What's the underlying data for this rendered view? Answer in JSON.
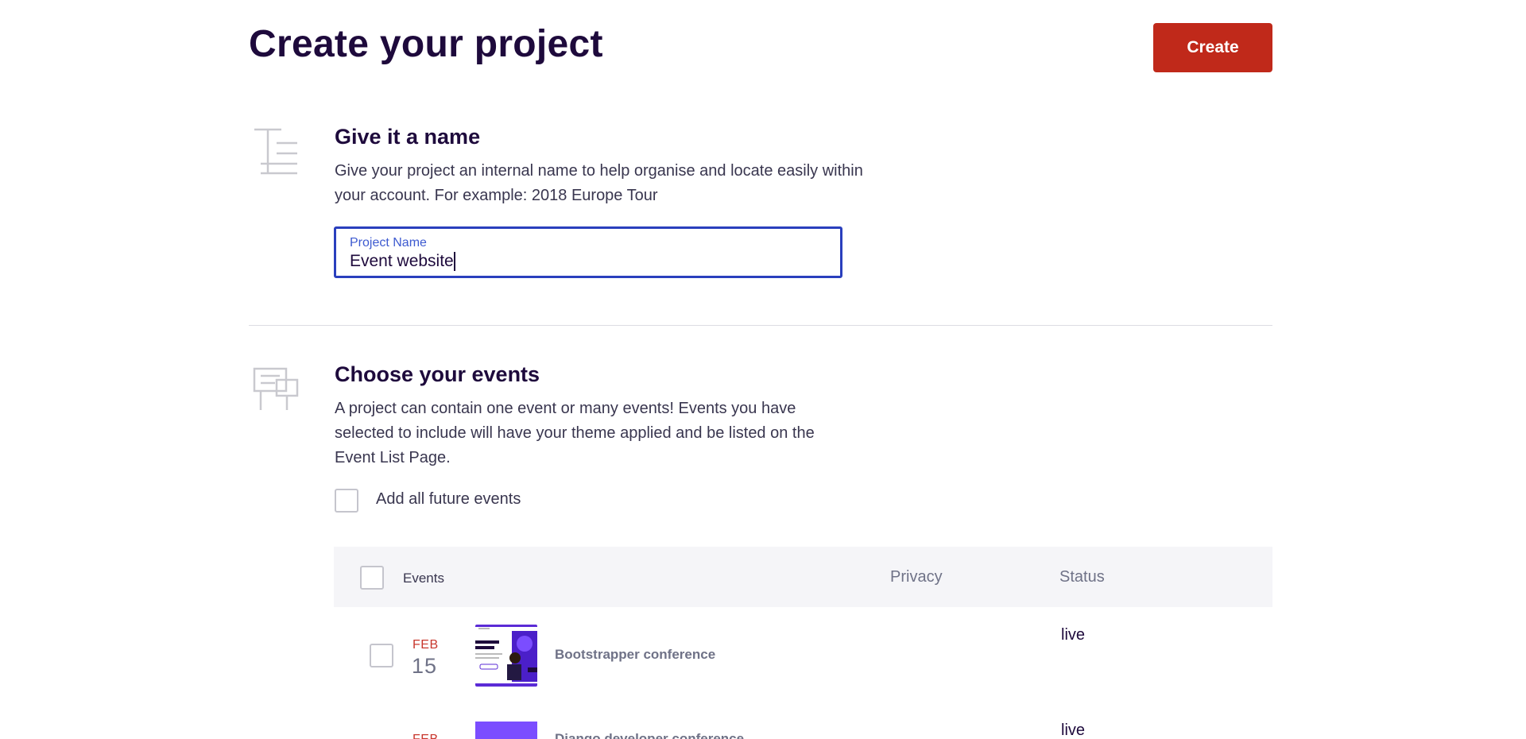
{
  "header": {
    "title": "Create your project",
    "create_label": "Create"
  },
  "name_section": {
    "icon": "text-lines-icon",
    "title": "Give it a name",
    "description_line1": "Give your project an internal name to help organise and locate easily within",
    "description_line2": "your account. For example: 2018 Europe Tour",
    "field": {
      "label": "Project Name",
      "value": "Event website"
    }
  },
  "events_section": {
    "icon": "signboard-icon",
    "title": "Choose your events",
    "description_line1": "A project can contain one event or many events! Events you have",
    "description_line2": "selected to include will have your theme applied and be listed on the",
    "description_line3": "Event List Page.",
    "future_events_label": "Add all future events",
    "table": {
      "headers": {
        "events": "Events",
        "privacy": "Privacy",
        "status": "Status"
      },
      "rows": [
        {
          "month": "FEB",
          "day": "15",
          "name": "Bootstrapper conference",
          "status": "live"
        },
        {
          "month": "FEB",
          "day": "",
          "name": "Django developer conference",
          "status": "live"
        }
      ]
    }
  },
  "colors": {
    "accent": "#c0291a",
    "focus": "#2a3fbd",
    "heading": "#1e0a3c",
    "thumb_purple": "#7b4dff"
  }
}
